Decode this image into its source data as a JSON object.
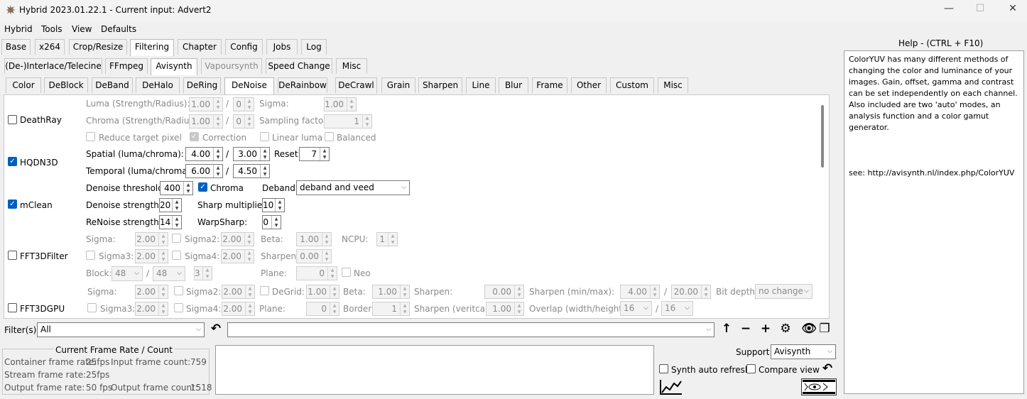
{
  "window": {
    "title": "Hybrid 2023.01.22.1 - Current input: Advert2",
    "minimize": "—",
    "maximize": "☐",
    "close": "✕"
  },
  "menu": [
    "Hybrid",
    "Tools",
    "View",
    "Defaults"
  ],
  "main_tabs": [
    "Base",
    "x264",
    "Crop/Resize",
    "Filtering",
    "Chapter",
    "Config",
    "Jobs",
    "Log"
  ],
  "filter_tabs": [
    "(De-)Interlace/Telecine",
    "FFmpeg",
    "Avisynth",
    "Vapoursynth",
    "Speed Change",
    "Misc"
  ],
  "avs_tabs": [
    "Color",
    "DeBlock",
    "DeBand",
    "DeHalo",
    "DeRing",
    "DeNoise",
    "DeRainbow",
    "DeCrawl",
    "Grain",
    "Sharpen",
    "Line",
    "Blur",
    "Frame",
    "Other",
    "Custom",
    "Misc"
  ],
  "deathray": {
    "label": "DeathRay",
    "luma_label": "Luma (Strength/Radius):",
    "luma": "1.00",
    "luma_r": "0",
    "sigma_label": "Sigma:",
    "sigma": "1.00",
    "chroma_label": "Chroma (Strength/Radius):",
    "chroma": "1.00",
    "chroma_r": "0",
    "sampling_label": "Sampling factor:",
    "sampling": "1",
    "reduce": "Reduce target pixel",
    "correction": "Correction",
    "linear": "Linear luma",
    "balanced": "Balanced"
  },
  "hqdn3d": {
    "label": "HQDN3D",
    "spatial_label": "Spatial (luma/chroma):",
    "spatial_l": "4.00",
    "spatial_c": "3.00",
    "reset_label": "Reset:",
    "reset": "7",
    "temporal_label": "Temporal (luma/chroma):",
    "temporal_l": "6.00",
    "temporal_c": "4.50"
  },
  "mclean": {
    "label": "mClean",
    "threshold_label": "Denoise threshold:",
    "threshold": "400",
    "chroma": "Chroma",
    "deband_label": "Deband:",
    "deband": "deband and veed",
    "strength_label": "Denoise strength:",
    "strength": "20",
    "sharp_label": "Sharp multiplier:",
    "sharp": "10",
    "renoise_label": "ReNoise strength:",
    "renoise": "14",
    "warp_label": "WarpSharp:",
    "warp": "0"
  },
  "fft3d": {
    "label": "FFT3DFilter",
    "sigma_label": "Sigma:",
    "sigma": "2.00",
    "sigma2_label": "Sigma2:",
    "sigma2": "2.00",
    "beta_label": "Beta:",
    "beta": "1.00",
    "ncpu_label": "NCPU:",
    "ncpu": "1",
    "sigma3_label": "Sigma3:",
    "sigma3": "2.00",
    "sigma4_label": "Sigma4:",
    "sigma4": "2.00",
    "sharpen_label": "Sharpen:",
    "sharpen": "0.00",
    "block_label": "Block:",
    "block_w": "48",
    "block_h": "48",
    "block_o": "3",
    "plane_label": "Plane:",
    "plane": "0",
    "neo": "Neo"
  },
  "fft3dgpu": {
    "label": "FFT3DGPU",
    "sigma_label": "Sigma:",
    "sigma": "2.00",
    "sigma2_label": "Sigma2:",
    "sigma2": "2.00",
    "degrid_label": "DeGrid:",
    "degrid": "1.00",
    "beta_label": "Beta:",
    "beta": "1.00",
    "sharpen_label": "Sharpen:",
    "sharpen": "0.00",
    "sharpen_mm_label": "Sharpen (min/max):",
    "sharpen_min": "4.00",
    "sharpen_max": "20.00",
    "bitdepth_label": "Bit depth:",
    "bitdepth": "no change",
    "sigma3_label": "Sigma3:",
    "sigma3": "2.00",
    "sigma4_label": "Sigma4:",
    "sigma4": "2.00",
    "plane_label": "Plane:",
    "plane": "0",
    "border_label": "Border:",
    "border": "1",
    "sharpen_v_label": "Sharpen (veritcal):",
    "sharpen_v": "1.00",
    "overlap_label": "Overlap (width/height):",
    "overlap_w": "16",
    "overlap_h": "16"
  },
  "filter_bar": {
    "label": "Filter(s):",
    "value": "All"
  },
  "help": {
    "title": "Help - (CTRL + F10)",
    "text": "ColorYUV has many different methods of changing the color and luminance of your images. Gain, offset, gamma and contrast can be set independently on each channel. Also included are two 'auto' modes, an analysis function and a color gamut generator.",
    "link": "see: http://avisynth.nl/index.php/ColorYUV"
  },
  "frame_rate": {
    "title": "Current Frame Rate / Count",
    "container_label": "Container frame rate:",
    "container": "25fps",
    "input_count_label": "Input frame count:",
    "input_count": "759",
    "stream_label": "Stream frame rate:",
    "stream": "25fps",
    "output_label": "Output frame rate:",
    "output": "50 fps",
    "output_count_label": "Output frame count:",
    "output_count": "1518"
  },
  "support": {
    "label": "Support:",
    "value": "Avisynth",
    "synth_auto": "Synth auto refresh",
    "compare": "Compare view"
  },
  "colors": {
    "accent": "#0060c0"
  }
}
